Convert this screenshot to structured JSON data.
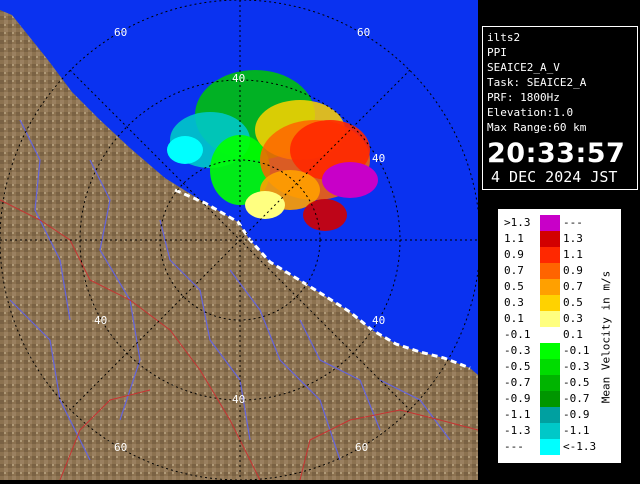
{
  "info": {
    "station": "ilts2",
    "mode": "PPI",
    "product": "SEAICE2_A_V",
    "task": "Task: SEAICE2_A",
    "prf": "PRF: 1800Hz",
    "elevation": "Elevation:1.0",
    "max_range": "Max Range:60 km",
    "time": "20:33:57",
    "date": "4 DEC 2024 JST"
  },
  "legend": {
    "title": "Mean Velocity in m/s",
    "rows": [
      {
        "left": ">1.3",
        "right": "---",
        "color": "#c800c8"
      },
      {
        "left": "1.1",
        "right": "1.3",
        "color": "#d20000"
      },
      {
        "left": "0.9",
        "right": "1.1",
        "color": "#ff2800"
      },
      {
        "left": "0.7",
        "right": "0.9",
        "color": "#ff6400"
      },
      {
        "left": "0.5",
        "right": "0.7",
        "color": "#ffa000"
      },
      {
        "left": "0.3",
        "right": "0.5",
        "color": "#ffd200"
      },
      {
        "left": "0.1",
        "right": "0.3",
        "color": "#ffff80"
      },
      {
        "left": "-0.1",
        "right": "0.1",
        "color": "#ffffff"
      },
      {
        "left": "-0.3",
        "right": "-0.1",
        "color": "#00ff00"
      },
      {
        "left": "-0.5",
        "right": "-0.3",
        "color": "#00dc00"
      },
      {
        "left": "-0.7",
        "right": "-0.5",
        "color": "#00b400"
      },
      {
        "left": "-0.9",
        "right": "-0.7",
        "color": "#009600"
      },
      {
        "left": "-1.1",
        "right": "-0.9",
        "color": "#00a0a0"
      },
      {
        "left": "-1.3",
        "right": "-1.1",
        "color": "#00c8c8"
      },
      {
        "left": "---",
        "right": "<-1.3",
        "color": "#00ffff"
      }
    ]
  },
  "range_labels": {
    "r60": "60",
    "r40": "40"
  },
  "colors": {
    "sea": "#0a32f0",
    "land": "#8c7250",
    "rivers": "#6464dc",
    "boundaries": "#c83232",
    "rings": "#000000"
  }
}
